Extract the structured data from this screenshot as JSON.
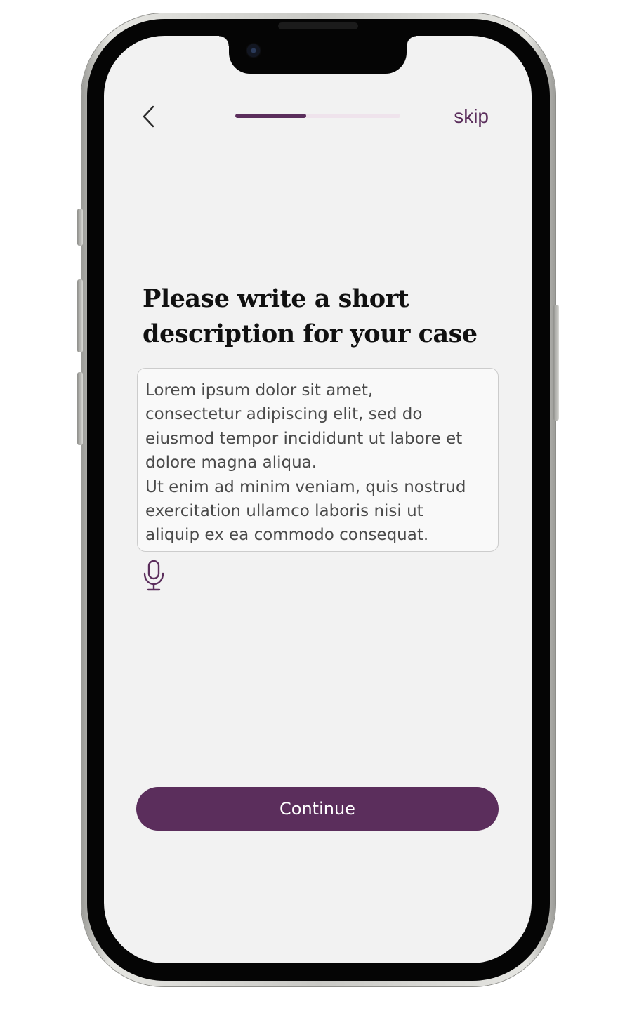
{
  "header": {
    "back_icon": "chevron-left-icon",
    "skip_label": "skip",
    "progress_fraction": 0.43
  },
  "main": {
    "title": "Please write a short description for your case",
    "description_value": "Lorem ipsum dolor sit amet,\nconsectetur adipiscing elit, sed do\neiusmod tempor incididunt ut labore et\ndolore magna aliqua.\nUt enim ad minim veniam, quis nostrud\nexercitation ullamco laboris nisi ut\naliquip ex ea commodo consequat.",
    "mic_icon": "microphone-icon",
    "continue_label": "Continue"
  },
  "colors": {
    "accent": "#5b2e5c",
    "progress_track": "#efe3ec",
    "screen_background": "#f2f2f2",
    "title_text": "#111111",
    "field_text": "#4a4a4a"
  }
}
